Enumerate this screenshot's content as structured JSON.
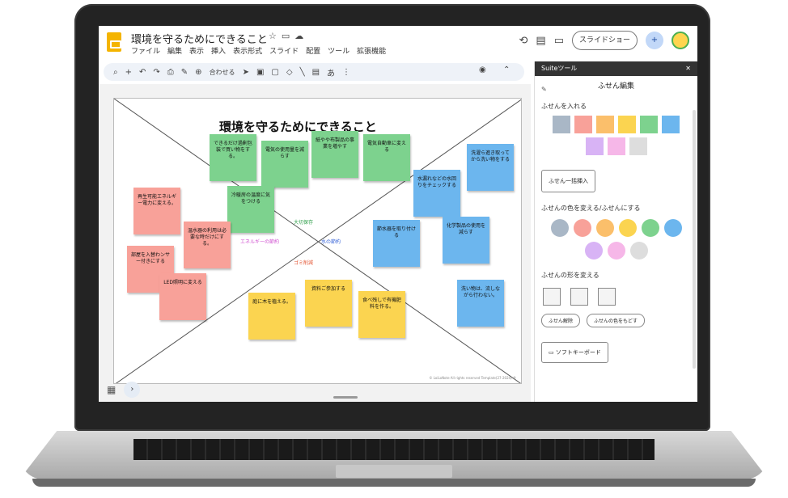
{
  "app": {
    "title": "環境を守るためにできること",
    "menu": [
      "ファイル",
      "編集",
      "表示",
      "挿入",
      "表示形式",
      "スライド",
      "配置",
      "ツール",
      "拡張機能"
    ],
    "slideshow": "スライドショー",
    "zoom": "合わせる"
  },
  "slide": {
    "title": "環境を守るためにできること",
    "labels": [
      "大切保存",
      "エネルギーの節約",
      "水の節約",
      "ゴミ削減"
    ],
    "copyright": "© LoiLoNote All rights reserved Template(27-2024) ®",
    "notes": [
      {
        "text": "できるだけ過剰包装で買い物をする。",
        "color": "green"
      },
      {
        "text": "電気の使用量を減らす",
        "color": "green"
      },
      {
        "text": "紙やや布製品の事業を増やす",
        "color": "green"
      },
      {
        "text": "電気自動車に変える",
        "color": "green"
      },
      {
        "text": "冷暖房の温度に気をつける",
        "color": "green"
      },
      {
        "text": "再生可能エネルギー電力に変える。",
        "color": "pink"
      },
      {
        "text": "温水器の利用は必要な時だけにする。",
        "color": "pink"
      },
      {
        "text": "部屋を入替わンサー付きにする",
        "color": "pink"
      },
      {
        "text": "LED照明に変える",
        "color": "pink"
      },
      {
        "text": "洗濯ら進き取ってから洗い物をする",
        "color": "blue"
      },
      {
        "text": "水漏れなどの水回りをチェックする",
        "color": "blue"
      },
      {
        "text": "節水器を取り付ける",
        "color": "blue"
      },
      {
        "text": "化学製品の使用を減らす",
        "color": "blue"
      },
      {
        "text": "洗い物は、流しながら行わない。",
        "color": "blue"
      },
      {
        "text": "庭に木を植える。",
        "color": "yellow"
      },
      {
        "text": "資料ご参加する",
        "color": "yellow"
      },
      {
        "text": "食べ残しで有機肥料を作る。",
        "color": "yellow"
      }
    ]
  },
  "panel": {
    "header": "Suiteツール",
    "subtitle": "ふせん編集",
    "insert_title": "ふせんを入れる",
    "square_colors": [
      "#a9b7c6",
      "#f8a199",
      "#fbbf6b",
      "#fbd450",
      "#7dd28e",
      "#6cb6ee",
      "#d8b3f5",
      "#f6b7e8",
      "#dddddd"
    ],
    "batch_button": "ふせん一括挿入",
    "color_title": "ふせんの色を変える/ふせんにする",
    "circle_colors": [
      "#a9b7c6",
      "#f8a199",
      "#fbbf6b",
      "#fbd450",
      "#7dd28e",
      "#6cb6ee",
      "#d8b3f5",
      "#f6b7e8",
      "#dddddd"
    ],
    "shape_title": "ふせんの形を変える",
    "btn1": "ふせん解除",
    "btn2": "ふせんの色をもどす",
    "keyboard": "ソフトキーボード"
  }
}
